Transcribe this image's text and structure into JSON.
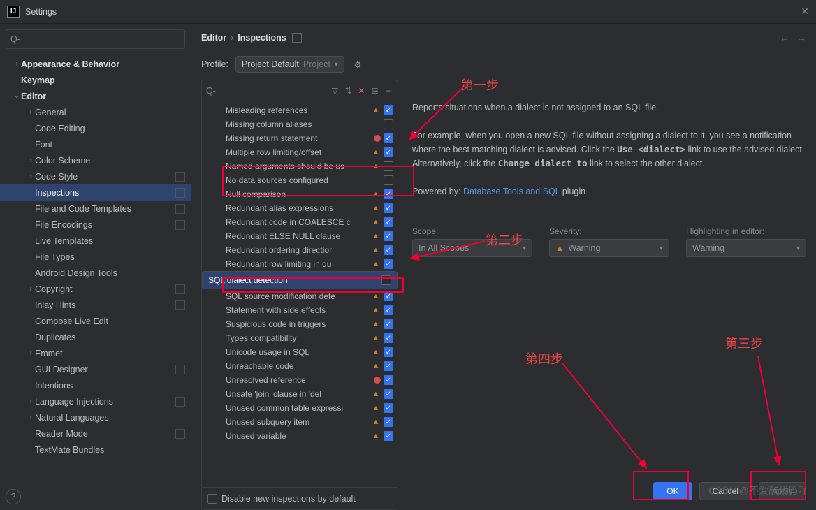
{
  "window": {
    "title": "Settings"
  },
  "breadcrumb": {
    "a": "Editor",
    "b": "Inspections"
  },
  "search_placeholder": "",
  "profile": {
    "label": "Profile:",
    "value": "Project Default",
    "suffix": "Project"
  },
  "nav": [
    {
      "label": "Appearance & Behavior",
      "depth": 0,
      "arrow": "right",
      "bold": true
    },
    {
      "label": "Keymap",
      "depth": 0,
      "bold": true
    },
    {
      "label": "Editor",
      "depth": 0,
      "arrow": "down",
      "bold": true
    },
    {
      "label": "General",
      "depth": 1,
      "arrow": "right"
    },
    {
      "label": "Code Editing",
      "depth": 1
    },
    {
      "label": "Font",
      "depth": 1
    },
    {
      "label": "Color Scheme",
      "depth": 1,
      "arrow": "right"
    },
    {
      "label": "Code Style",
      "depth": 1,
      "arrow": "right",
      "ext": true
    },
    {
      "label": "Inspections",
      "depth": 1,
      "ext": true,
      "selected": true
    },
    {
      "label": "File and Code Templates",
      "depth": 1,
      "ext": true
    },
    {
      "label": "File Encodings",
      "depth": 1,
      "ext": true
    },
    {
      "label": "Live Templates",
      "depth": 1
    },
    {
      "label": "File Types",
      "depth": 1
    },
    {
      "label": "Android Design Tools",
      "depth": 1
    },
    {
      "label": "Copyright",
      "depth": 1,
      "arrow": "right",
      "ext": true
    },
    {
      "label": "Inlay Hints",
      "depth": 1,
      "ext": true
    },
    {
      "label": "Compose Live Edit",
      "depth": 1
    },
    {
      "label": "Duplicates",
      "depth": 1
    },
    {
      "label": "Emmet",
      "depth": 1,
      "arrow": "right"
    },
    {
      "label": "GUI Designer",
      "depth": 1,
      "ext": true
    },
    {
      "label": "Intentions",
      "depth": 1
    },
    {
      "label": "Language Injections",
      "depth": 1,
      "arrow": "right",
      "ext": true
    },
    {
      "label": "Natural Languages",
      "depth": 1,
      "arrow": "right"
    },
    {
      "label": "Reader Mode",
      "depth": 1,
      "ext": true
    },
    {
      "label": "TextMate Bundles",
      "depth": 1
    }
  ],
  "inspections": [
    {
      "label": "Misleading references",
      "icon": "tri",
      "checked": true
    },
    {
      "label": "Missing column aliases",
      "icon": "",
      "checked": false
    },
    {
      "label": "Missing return statement",
      "icon": "err",
      "checked": true
    },
    {
      "label": "Multiple row limiting/offset",
      "icon": "tri",
      "checked": true
    },
    {
      "label": "Named arguments should be us",
      "icon": "tri",
      "checked": false
    },
    {
      "label": "No data sources configured",
      "icon": "",
      "checked": false
    },
    {
      "label": "Null comparison",
      "icon": "tri",
      "checked": true
    },
    {
      "label": "Redundant alias expressions",
      "icon": "tri",
      "checked": true
    },
    {
      "label": "Redundant code in COALESCE c",
      "icon": "tri",
      "checked": true
    },
    {
      "label": "Redundant ELSE NULL clause",
      "icon": "tri",
      "checked": true
    },
    {
      "label": "Redundant ordering directior",
      "icon": "tri",
      "checked": true
    },
    {
      "label": "Redundant row limiting in qu",
      "icon": "tri",
      "checked": true
    },
    {
      "label": "SQL dialect detection",
      "icon": "",
      "checked": false,
      "selected": true
    },
    {
      "label": "SQL source modification dete",
      "icon": "tri",
      "checked": true
    },
    {
      "label": "Statement with side effects",
      "icon": "tri",
      "checked": true
    },
    {
      "label": "Suspicious code in triggers",
      "icon": "tri",
      "checked": true
    },
    {
      "label": "Types compatibility",
      "icon": "tri",
      "checked": true
    },
    {
      "label": "Unicode usage in SQL",
      "icon": "tri",
      "checked": true
    },
    {
      "label": "Unreachable code",
      "icon": "tri",
      "checked": true
    },
    {
      "label": "Unresolved reference",
      "icon": "err",
      "checked": true
    },
    {
      "label": "Unsafe 'join' clause in 'del",
      "icon": "tri",
      "checked": true
    },
    {
      "label": "Unused common table expressi",
      "icon": "tri",
      "checked": true
    },
    {
      "label": "Unused subquery item",
      "icon": "tri",
      "checked": true
    },
    {
      "label": "Unused variable",
      "icon": "tri",
      "checked": true
    }
  ],
  "tree_footer": "Disable new inspections by default",
  "desc": {
    "p1": "Reports situations when a dialect is not assigned to an SQL file.",
    "p2a": "For example, when you open a new SQL file without assigning a dialect to it, you see a notification where the best matching dialect is advised. Click the ",
    "p2_mono1": "Use <dialect>",
    "p2b": " link to use the advised dialect. Alternatively, click the ",
    "p2_mono2": "Change dialect to",
    "p2c": " link to select the other dialect.",
    "p3a": "Powered by: ",
    "p3_link": "Database Tools and SQL",
    "p3b": " plugin"
  },
  "scope": {
    "label": "Scope:",
    "value": "In All Scopes"
  },
  "severity": {
    "label": "Severity:",
    "value": "Warning"
  },
  "highlight": {
    "label": "Highlighting in editor:",
    "value": "Warning"
  },
  "buttons": {
    "ok": "OK",
    "cancel": "Cancel",
    "apply": "Apply"
  },
  "anno": {
    "s1": "第一步",
    "s2": "第二步",
    "s3": "第三步",
    "s4": "第四步"
  },
  "watermark": "CSDN @不爱敲代码吖"
}
